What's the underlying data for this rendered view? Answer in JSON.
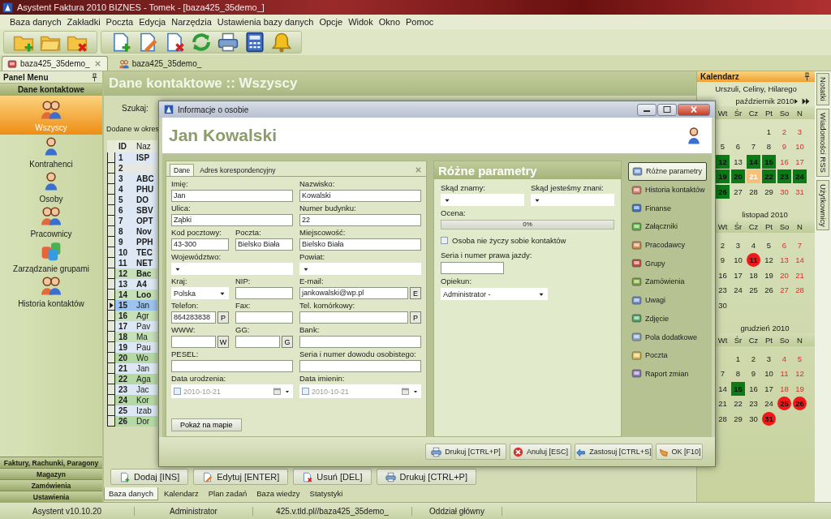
{
  "window": {
    "title": "Asystent Faktura 2010 BIZNES - Tomek - [baza425_35demo_]"
  },
  "menu": [
    "Baza danych",
    "Zakładki",
    "Poczta",
    "Edycja",
    "Narzędzia",
    "Ustawienia bazy danych",
    "Opcje",
    "Widok",
    "Okno",
    "Pomoc"
  ],
  "doc_tabs": [
    {
      "label": "baza425_35demo_",
      "selected": true
    },
    {
      "label": "baza425_35demo_",
      "selected": false
    }
  ],
  "panel_menu": {
    "title": "Panel Menu",
    "section": "Dane kontaktowe",
    "items": [
      {
        "label": "Wszyscy",
        "selected": true
      },
      {
        "label": "Kontrahenci",
        "selected": false
      },
      {
        "label": "Osoby",
        "selected": false
      },
      {
        "label": "Pracownicy",
        "selected": false
      },
      {
        "label": "Zarządzanie grupami",
        "selected": false
      },
      {
        "label": "Historia kontaktów",
        "selected": false
      }
    ],
    "groups": [
      "Faktury, Rachunki, Paragony",
      "Magazyn",
      "Zamówienia",
      "Ustawienia"
    ]
  },
  "content": {
    "title": "Dane kontaktowe :: Wszyscy",
    "search_label": "Szukaj:",
    "period_label": "Dodane w okres",
    "table": {
      "columns": [
        "ID",
        "Naz"
      ],
      "rows": [
        {
          "number": "1",
          "name": "ISP",
          "kind": "company",
          "selected": false,
          "color": "#dde8f4"
        },
        {
          "number": "2",
          "kind": "company",
          "selected": false,
          "color": "#e6e8e4"
        },
        {
          "number": "3",
          "name": "ABC",
          "kind": "company",
          "selected": false,
          "color": "#dde8f4"
        },
        {
          "number": "4",
          "name": "PHU",
          "kind": "company",
          "selected": false,
          "color": "#dde8f4"
        },
        {
          "number": "5",
          "name": "DO",
          "kind": "company",
          "selected": false,
          "color": "#dde8f4"
        },
        {
          "number": "6",
          "name": "SBV",
          "kind": "company",
          "selected": false,
          "color": "#dde8f4"
        },
        {
          "number": "7",
          "name": "OPT",
          "kind": "company",
          "selected": false,
          "color": "#dde8f4"
        },
        {
          "number": "8",
          "name": "Nov",
          "kind": "company",
          "selected": false,
          "color": "#dde8f4"
        },
        {
          "number": "9",
          "name": "PPH",
          "kind": "company",
          "selected": false,
          "color": "#dde8f4"
        },
        {
          "number": "10",
          "name": "TEC",
          "kind": "company",
          "selected": false,
          "color": "#dde8f4"
        },
        {
          "number": "11",
          "name": "NET",
          "kind": "company",
          "selected": false,
          "color": "#dde8f4"
        },
        {
          "number": "12",
          "name": "Bac",
          "kind": "company",
          "selected": false,
          "color": "#c6e0b8"
        },
        {
          "number": "13",
          "name": "A4",
          "kind": "company",
          "selected": false,
          "color": "#dde8f4"
        },
        {
          "number": "14",
          "name": "Loo",
          "kind": "company",
          "selected": false,
          "color": "#c6e0b8"
        },
        {
          "number": "15",
          "name": "Jan",
          "kind": "person",
          "selected": true
        },
        {
          "number": "16",
          "name": "Agr",
          "kind": "person",
          "selected": false,
          "color": "#c6e0b8"
        },
        {
          "number": "17",
          "name": "Pav",
          "kind": "person",
          "selected": false,
          "color": "#dde8f4"
        },
        {
          "number": "18",
          "name": "Ma",
          "kind": "person",
          "selected": false,
          "color": "#c6e0b8"
        },
        {
          "number": "19",
          "name": "Pau",
          "kind": "person",
          "selected": false,
          "color": "#dde8f4"
        },
        {
          "number": "20",
          "name": "Wo",
          "kind": "person",
          "selected": false,
          "color": "#b5d9a4"
        },
        {
          "number": "21",
          "name": "Jan",
          "kind": "person",
          "selected": false,
          "color": "#dde8f4"
        },
        {
          "number": "22",
          "name": "Aga",
          "kind": "person",
          "selected": false,
          "color": "#b5d9a4"
        },
        {
          "number": "23",
          "name": "Jac",
          "kind": "person",
          "selected": false,
          "color": "#dde8f4"
        },
        {
          "number": "24",
          "name": "Kor",
          "kind": "person",
          "selected": false,
          "color": "#b5d9a4"
        },
        {
          "number": "25",
          "name": "Izab",
          "kind": "person",
          "selected": false,
          "color": "#dde8f4"
        },
        {
          "number": "26",
          "name": "Dor",
          "kind": "person",
          "selected": false,
          "color": "#b5d9a4"
        }
      ]
    },
    "buttons": [
      "Dodaj [INS]",
      "Edytuj [ENTER]",
      "Usuń [DEL]",
      "Drukuj [CTRL+P]"
    ],
    "tabs": [
      {
        "label": "Baza danych",
        "selected": true
      },
      {
        "label": "Kalendarz",
        "selected": false
      },
      {
        "label": "Plan zadań",
        "selected": false
      },
      {
        "label": "Baza wiedzy",
        "selected": false
      },
      {
        "label": "Statystyki",
        "selected": false
      }
    ]
  },
  "calendar": {
    "title": "Kalendarz",
    "names": "Urszuli, Celiny, Hilarego",
    "months": [
      {
        "title": "październik 2010",
        "show_nav": true,
        "weekdays": [
          "Wt",
          "Śr",
          "Cz",
          "Pt",
          "So",
          "N"
        ],
        "weeks": [
          [
            {
              "d": "1",
              "kind": "plain"
            },
            {
              "d": "2",
              "kind": "plain"
            },
            {
              "d": "3",
              "kind": "plain"
            }
          ],
          [
            {
              "d": "5",
              "kind": "plain"
            },
            {
              "d": "6",
              "kind": "plain"
            },
            {
              "d": "7",
              "kind": "plain"
            },
            {
              "d": "8",
              "kind": "plain"
            },
            {
              "d": "9",
              "kind": "plain"
            },
            {
              "d": "10",
              "kind": "plain"
            }
          ],
          [
            {
              "d": "12",
              "kind": "event"
            },
            {
              "d": "13",
              "kind": "plain"
            },
            {
              "d": "14",
              "kind": "event"
            },
            {
              "d": "15",
              "kind": "event"
            },
            {
              "d": "16",
              "kind": "plain"
            },
            {
              "d": "17",
              "kind": "plain"
            }
          ],
          [
            {
              "d": "19",
              "kind": "event"
            },
            {
              "d": "20",
              "kind": "event"
            },
            {
              "d": "21",
              "kind": "today"
            },
            {
              "d": "22",
              "kind": "event"
            },
            {
              "d": "23",
              "kind": "event"
            },
            {
              "d": "24",
              "kind": "event"
            }
          ],
          [
            {
              "d": "26",
              "kind": "event"
            },
            {
              "d": "27",
              "kind": "plain"
            },
            {
              "d": "28",
              "kind": "plain"
            },
            {
              "d": "29",
              "kind": "plain"
            },
            {
              "d": "30",
              "kind": "plain"
            },
            {
              "d": "31",
              "kind": "plain"
            }
          ]
        ]
      },
      {
        "title": "listopad 2010",
        "show_nav": false,
        "weekdays": [
          "Wt",
          "Śr",
          "Cz",
          "Pt",
          "So",
          "N"
        ],
        "weeks": [
          [
            {
              "d": "2",
              "kind": "plain"
            },
            {
              "d": "3",
              "kind": "plain"
            },
            {
              "d": "4",
              "kind": "plain"
            },
            {
              "d": "5",
              "kind": "plain"
            },
            {
              "d": "6",
              "kind": "plain"
            },
            {
              "d": "7",
              "kind": "plain"
            }
          ],
          [
            {
              "d": "9",
              "kind": "plain"
            },
            {
              "d": "10",
              "kind": "plain"
            },
            {
              "d": "11",
              "kind": "holiday"
            },
            {
              "d": "12",
              "kind": "plain"
            },
            {
              "d": "13",
              "kind": "plain"
            },
            {
              "d": "14",
              "kind": "plain"
            }
          ],
          [
            {
              "d": "16",
              "kind": "plain"
            },
            {
              "d": "17",
              "kind": "plain"
            },
            {
              "d": "18",
              "kind": "plain"
            },
            {
              "d": "19",
              "kind": "plain"
            },
            {
              "d": "20",
              "kind": "plain"
            },
            {
              "d": "21",
              "kind": "plain"
            }
          ],
          [
            {
              "d": "23",
              "kind": "plain"
            },
            {
              "d": "24",
              "kind": "plain"
            },
            {
              "d": "25",
              "kind": "plain"
            },
            {
              "d": "26",
              "kind": "plain"
            },
            {
              "d": "27",
              "kind": "plain"
            },
            {
              "d": "28",
              "kind": "plain"
            }
          ],
          [
            {
              "d": "30",
              "kind": "plain"
            }
          ]
        ]
      },
      {
        "title": "grudzień 2010",
        "show_nav": false,
        "weekdays": [
          "Wt",
          "Śr",
          "Cz",
          "Pt",
          "So",
          "N"
        ],
        "weeks": [
          [
            {
              "d": "1",
              "kind": "plain"
            },
            {
              "d": "2",
              "kind": "plain"
            },
            {
              "d": "3",
              "kind": "plain"
            },
            {
              "d": "4",
              "kind": "plain"
            },
            {
              "d": "5",
              "kind": "plain"
            }
          ],
          [
            {
              "d": "7",
              "kind": "plain"
            },
            {
              "d": "8",
              "kind": "plain"
            },
            {
              "d": "9",
              "kind": "plain"
            },
            {
              "d": "10",
              "kind": "plain"
            },
            {
              "d": "11",
              "kind": "plain"
            },
            {
              "d": "12",
              "kind": "plain"
            }
          ],
          [
            {
              "d": "14",
              "kind": "plain"
            },
            {
              "d": "15",
              "kind": "event"
            },
            {
              "d": "16",
              "kind": "plain"
            },
            {
              "d": "17",
              "kind": "plain"
            },
            {
              "d": "18",
              "kind": "plain"
            },
            {
              "d": "19",
              "kind": "plain"
            }
          ],
          [
            {
              "d": "21",
              "kind": "plain"
            },
            {
              "d": "22",
              "kind": "plain"
            },
            {
              "d": "23",
              "kind": "plain"
            },
            {
              "d": "24",
              "kind": "plain"
            },
            {
              "d": "25",
              "kind": "holiday"
            },
            {
              "d": "26",
              "kind": "holiday"
            }
          ],
          [
            {
              "d": "28",
              "kind": "plain"
            },
            {
              "d": "29",
              "kind": "plain"
            },
            {
              "d": "30",
              "kind": "plain"
            },
            {
              "d": "31",
              "kind": "holiday"
            }
          ]
        ]
      }
    ]
  },
  "side_tabs": [
    "Notatki",
    "Wiadomości RSS",
    "Użytkownicy"
  ],
  "dialog": {
    "title": "Informacje o osobie",
    "heading": "Jan Kowalski",
    "tabs": [
      {
        "label": "Dane",
        "selected": true
      },
      {
        "label": "Adres korespondencyjny",
        "selected": false
      }
    ],
    "fields": [
      {
        "label": "Imię:",
        "value": "Jan",
        "kind": "text",
        "wide": true
      },
      {
        "label": "Nazwisko:",
        "value": "Kowalski",
        "kind": "text",
        "wide": true
      },
      {
        "label": "Ulica:",
        "value": "Ząbki",
        "kind": "text",
        "wide": true
      },
      {
        "label": "Numer budynku:",
        "value": "22",
        "kind": "text",
        "wide": true
      },
      {
        "label": "Kod pocztowy:",
        "value": "43-300",
        "kind": "text",
        "wide": false
      },
      {
        "label": "Poczta:",
        "value": "Bielsko Biała",
        "kind": "text",
        "wide": false
      },
      {
        "label": "Miejscowość:",
        "value": "Bielsko Biała",
        "kind": "text",
        "wide": true
      },
      {
        "label": "Województwo:",
        "kind": "select",
        "wide": true
      },
      {
        "label": "Powiat:",
        "kind": "select",
        "wide": true
      },
      {
        "label": "Kraj:",
        "value": "Polska",
        "kind": "select",
        "wide": false
      },
      {
        "label": "NIP:",
        "kind": "text",
        "wide": false
      },
      {
        "label": "E-mail:",
        "value": "jankowalski@wp.pl",
        "kind": "text",
        "wide": true,
        "button": "E"
      },
      {
        "label": "Telefon:",
        "value": "864283838",
        "kind": "text",
        "wide": false,
        "button": "P"
      },
      {
        "label": "Fax:",
        "kind": "text",
        "wide": false
      },
      {
        "label": "Tel. komórkowy:",
        "kind": "text",
        "wide": true,
        "button": "P"
      },
      {
        "label": "WWW:",
        "kind": "text",
        "wide": false,
        "button": "W"
      },
      {
        "label": "GG:",
        "kind": "text",
        "wide": false,
        "button": "G"
      },
      {
        "label": "Bank:",
        "kind": "text",
        "wide": true
      },
      {
        "label": "PESEL:",
        "kind": "text",
        "wide": true
      },
      {
        "label": "Seria i numer dowodu osobistego:",
        "kind": "text",
        "wide": true
      },
      {
        "label": "Data urodzenia:",
        "value": "2010-10-21",
        "kind": "date",
        "wide": true,
        "checked": false
      },
      {
        "label": "Data imienin:",
        "value": "2010-10-21",
        "kind": "date",
        "wide": true,
        "checked": false
      }
    ],
    "map_button": "Pokaż na mapie",
    "params": {
      "title": "Różne parametry",
      "source": {
        "label": "Skąd znamy:"
      },
      "known_from": {
        "label": "Skąd jesteśmy znani:"
      },
      "rating": {
        "label": "Ocena:",
        "level": 0,
        "reading": "0%"
      },
      "no_contact": {
        "label": "Osoba nie życzy sobie kontaktów",
        "checked": false
      },
      "license": {
        "label": "Seria i numer prawa jazdy:"
      },
      "guardian": {
        "label": "Opiekun:",
        "value": "Administrator -"
      }
    },
    "nav": [
      {
        "label": "Różne parametry",
        "selected": true
      },
      {
        "label": "Historia kontaktów",
        "selected": false
      },
      {
        "label": "Finanse",
        "selected": false
      },
      {
        "label": "Załączniki",
        "selected": false
      },
      {
        "label": "Pracodawcy",
        "selected": false
      },
      {
        "label": "Grupy",
        "selected": false
      },
      {
        "label": "Zamówienia",
        "selected": false
      },
      {
        "label": "Uwagi",
        "selected": false
      },
      {
        "label": "Zdjęcie",
        "selected": false
      },
      {
        "label": "Pola dodatkowe",
        "selected": false
      },
      {
        "label": "Poczta",
        "selected": false
      },
      {
        "label": "Raport zmian",
        "selected": false
      }
    ],
    "buttons": [
      "Drukuj [CTRL+P]",
      "Anuluj [ESC]",
      "Zastosuj [CTRL+S]",
      "OK [F10]"
    ]
  },
  "status_bar": [
    "Asystent v10.10.20",
    "Administrator",
    "425.v.tld.pl//baza425_35demo_",
    "Oddział główny"
  ]
}
